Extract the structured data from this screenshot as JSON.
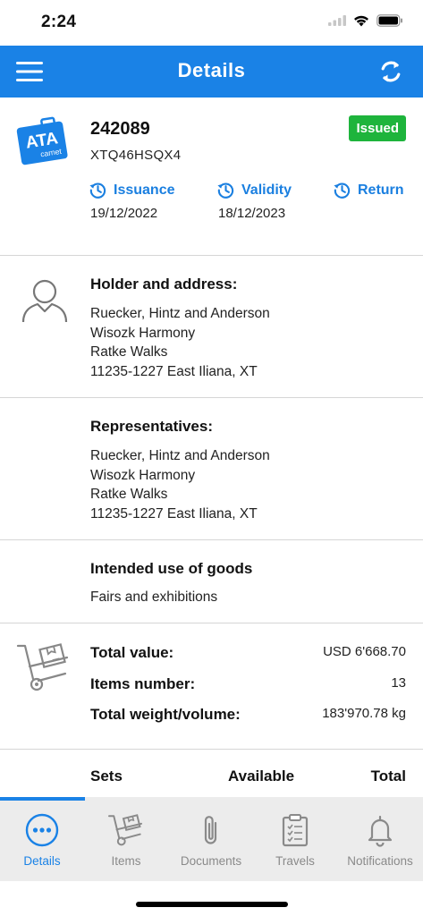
{
  "status_bar": {
    "time": "2:24"
  },
  "header": {
    "title": "Details",
    "menu_icon": "hamburger-menu-icon",
    "refresh_icon": "refresh-icon"
  },
  "carnet": {
    "number": "242089",
    "code": "XTQ46HSQX4",
    "status": "Issued",
    "status_color": "#1eb43c",
    "logo_text": "ATA",
    "logo_subtext": "carnet",
    "dates": [
      {
        "label": "Issuance",
        "value": "19/12/2022"
      },
      {
        "label": "Validity",
        "value": "18/12/2023"
      },
      {
        "label": "Return",
        "value": ""
      }
    ]
  },
  "holder": {
    "title": "Holder and address:",
    "lines": [
      "Ruecker, Hintz and Anderson",
      "Wisozk Harmony",
      "Ratke Walks",
      "11235-1227 East Iliana, XT"
    ]
  },
  "representatives": {
    "title": "Representatives:",
    "lines": [
      "Ruecker, Hintz and Anderson",
      "Wisozk Harmony",
      "Ratke Walks",
      "11235-1227 East Iliana, XT"
    ]
  },
  "intended_use": {
    "title": "Intended use of goods",
    "value": "Fairs and exhibitions"
  },
  "totals": [
    {
      "label": "Total value:",
      "value": "USD 6'668.70"
    },
    {
      "label": "Items number:",
      "value": "13"
    },
    {
      "label": "Total weight/volume:",
      "value": "183'970.78 kg"
    }
  ],
  "sets_table": {
    "columns": [
      "Sets",
      "Available",
      "Total"
    ]
  },
  "tabs": [
    {
      "label": "Details",
      "icon": "more-dots-icon",
      "active": true
    },
    {
      "label": "Items",
      "icon": "hand-truck-icon",
      "active": false
    },
    {
      "label": "Documents",
      "icon": "paperclip-icon",
      "active": false
    },
    {
      "label": "Travels",
      "icon": "clipboard-icon",
      "active": false
    },
    {
      "label": "Notifications",
      "icon": "bell-icon",
      "active": false
    }
  ],
  "colors": {
    "accent": "#1a82e6",
    "link": "#1a7fe0",
    "badge": "#1eb43c",
    "tab_bar": "#ececec"
  }
}
